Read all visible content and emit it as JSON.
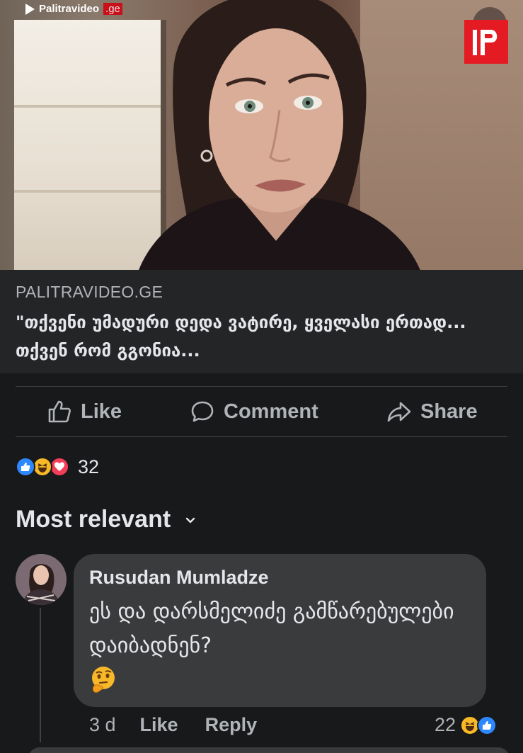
{
  "preview": {
    "watermark_name": "Palitravideo",
    "watermark_tld": ".ge",
    "logo_letter": "P"
  },
  "link": {
    "domain": "PALITRAVIDEO.GE",
    "title": "\"თქვენი უმადური დედა ვატირე, ყველასი ერთად... თქვენ რომ გგონია..."
  },
  "actions": {
    "like_label": "Like",
    "comment_label": "Comment",
    "share_label": "Share"
  },
  "reactions": {
    "count": "32",
    "types": [
      "like",
      "haha",
      "love"
    ]
  },
  "sort": {
    "label": "Most relevant"
  },
  "comments": [
    {
      "author": "Rusudan Mumladze",
      "text": "ეს და დარსმელიძე გამწარებულები დაიბადნენ?",
      "emoji": "thinking-face",
      "time": "3 d",
      "like_label": "Like",
      "reply_label": "Reply",
      "reaction_count": "22",
      "reaction_types": [
        "haha",
        "like"
      ]
    }
  ],
  "colors": {
    "background": "#18191a",
    "card": "#242526",
    "bubble": "#3a3b3c",
    "text_primary": "#e4e6eb",
    "text_secondary": "#b0b3b8",
    "like_blue": "#2d88ff",
    "haha_yellow": "#f7b928",
    "love_red": "#f33e58",
    "brand_red": "#e41b23"
  }
}
